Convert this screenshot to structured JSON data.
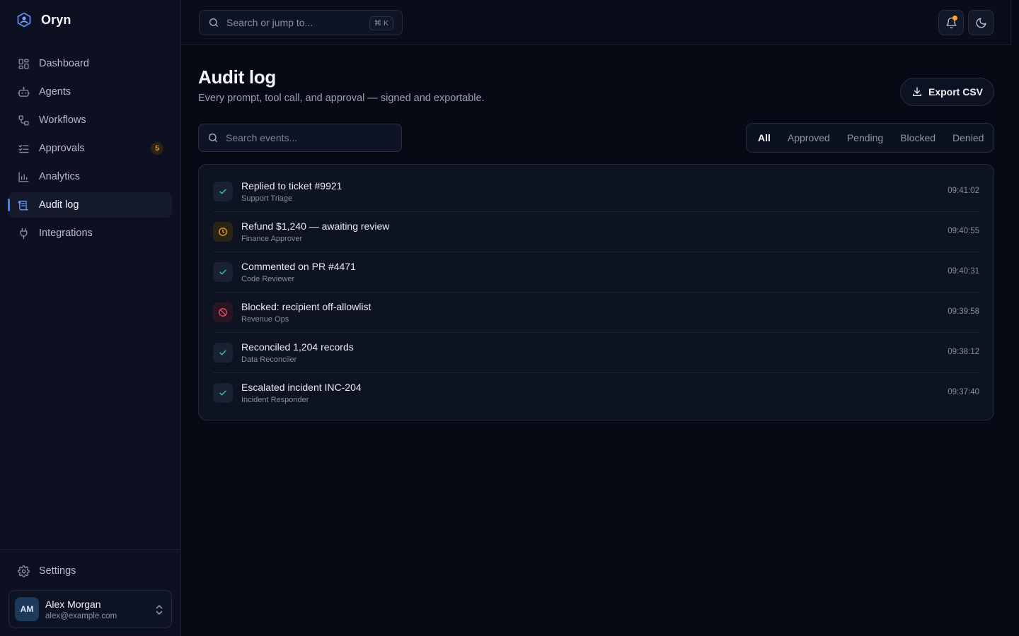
{
  "app": {
    "name": "Oryn"
  },
  "sidebar": {
    "items": [
      {
        "label": "Dashboard",
        "icon": "dashboard-icon"
      },
      {
        "label": "Agents",
        "icon": "robot-icon"
      },
      {
        "label": "Workflows",
        "icon": "workflow-icon"
      },
      {
        "label": "Approvals",
        "icon": "checklist-icon",
        "badge": "5"
      },
      {
        "label": "Analytics",
        "icon": "chart-icon"
      },
      {
        "label": "Audit log",
        "icon": "scroll-icon",
        "active": true
      },
      {
        "label": "Integrations",
        "icon": "plug-icon"
      }
    ],
    "settings_label": "Settings",
    "user": {
      "initials": "AM",
      "name": "Alex Morgan",
      "email": "alex@example.com"
    }
  },
  "topbar": {
    "search_placeholder": "Search or jump to...",
    "shortcut": "⌘ K"
  },
  "page": {
    "title": "Audit log",
    "subtitle": "Every prompt, tool call, and approval — signed and exportable.",
    "export_label": "Export CSV",
    "events_search_placeholder": "Search events...",
    "filters": [
      "All",
      "Approved",
      "Pending",
      "Blocked",
      "Denied"
    ],
    "active_filter": "All"
  },
  "events": [
    {
      "title": "Replied to ticket #9921",
      "agent": "Support Triage",
      "time": "09:41:02",
      "status": "approved"
    },
    {
      "title": "Refund $1,240 — awaiting review",
      "agent": "Finance Approver",
      "time": "09:40:55",
      "status": "pending"
    },
    {
      "title": "Commented on PR #4471",
      "agent": "Code Reviewer",
      "time": "09:40:31",
      "status": "approved"
    },
    {
      "title": "Blocked: recipient off-allowlist",
      "agent": "Revenue Ops",
      "time": "09:39:58",
      "status": "blocked"
    },
    {
      "title": "Reconciled 1,204 records",
      "agent": "Data Reconciler",
      "time": "09:38:12",
      "status": "approved"
    },
    {
      "title": "Escalated incident INC-204",
      "agent": "Incident Responder",
      "time": "09:37:40",
      "status": "approved"
    }
  ],
  "colors": {
    "accent": "#3b82f6",
    "approved": "#3ccf91",
    "pending": "#f5a524",
    "blocked": "#f0506e",
    "notification_dot": "#f5a524"
  }
}
